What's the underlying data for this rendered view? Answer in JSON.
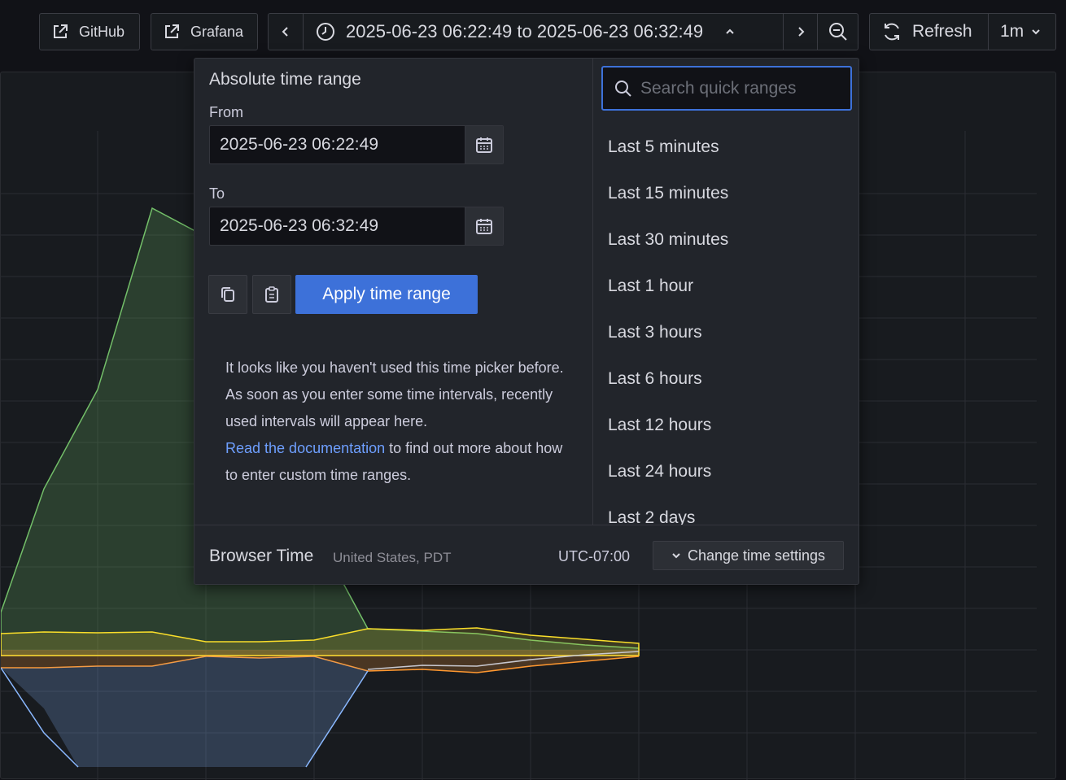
{
  "toolbar": {
    "github_label": "GitHub",
    "grafana_label": "Grafana",
    "time_range_label": "2025-06-23 06:22:49 to 2025-06-23 06:32:49",
    "refresh_label": "Refresh",
    "interval_label": "1m"
  },
  "picker": {
    "title": "Absolute time range",
    "from_label": "From",
    "from_value": "2025-06-23 06:22:49",
    "to_label": "To",
    "to_value": "2025-06-23 06:32:49",
    "apply_label": "Apply time range",
    "help_text": "It looks like you haven't used this time picker before. As soon as you enter some time intervals, recently used intervals will appear here.",
    "help_link": "Read the documentation",
    "help_suffix": " to find out more about how to enter custom time ranges.",
    "search_placeholder": "Search quick ranges",
    "quick_ranges": [
      "Last 5 minutes",
      "Last 15 minutes",
      "Last 30 minutes",
      "Last 1 hour",
      "Last 3 hours",
      "Last 6 hours",
      "Last 12 hours",
      "Last 24 hours",
      "Last 2 days"
    ]
  },
  "footer": {
    "browser_time": "Browser Time",
    "locale": "United States, PDT",
    "utc_offset": "UTC-07:00",
    "change_settings": "Change time settings"
  },
  "colors": {
    "accent": "#3d71d9",
    "link": "#6e9fff",
    "series_green": "#73bf69",
    "series_yellow": "#fade2a",
    "series_orange": "#ff9830",
    "series_blue": "#8ab8ff",
    "series_gray": "#c8c8d0"
  }
}
